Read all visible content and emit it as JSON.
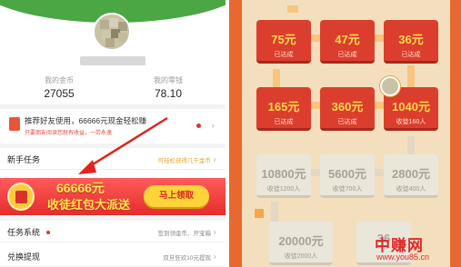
{
  "profile": {
    "coins_label": "我的金币",
    "coins_value": "27055",
    "change_label": "我的零钱",
    "change_value": "78.10"
  },
  "invite": {
    "text": "推荐好友使用，66666元现金轻松赚",
    "sub": "只要朋友阅读您就有收益，一劳永逸"
  },
  "rows": {
    "newbie": {
      "title": "新手任务",
      "hint": "可轻松获得几千金币"
    },
    "tasks": {
      "title": "任务系统",
      "hint": "签到领金币、开宝箱"
    },
    "withdraw": {
      "title": "兑换提现",
      "hint": "双旦狂欢10元提现"
    }
  },
  "banner": {
    "amount": "66666元",
    "text": "收徒红包大派送",
    "button": "马上领取"
  },
  "reward_map": {
    "cards": [
      {
        "amount": "75元",
        "status": "已达成",
        "done": true
      },
      {
        "amount": "47元",
        "status": "已达成",
        "done": true
      },
      {
        "amount": "36元",
        "status": "已达成",
        "done": true
      },
      {
        "amount": "165元",
        "status": "已达成",
        "done": true
      },
      {
        "amount": "360元",
        "status": "已达成",
        "done": true
      },
      {
        "amount": "1040元",
        "status": "收徒160人",
        "done": true
      },
      {
        "amount": "10800元",
        "status": "收徒1200人",
        "done": false
      },
      {
        "amount": "5600元",
        "status": "收徒700人",
        "done": false
      },
      {
        "amount": "2800元",
        "status": "收徒400人",
        "done": false
      },
      {
        "amount": "20000元",
        "status": "收徒2000人",
        "done": false
      },
      {
        "amount": "36",
        "status": "",
        "done": false
      }
    ]
  },
  "watermark": {
    "cn": "中赚网",
    "url": "www.you85.cn"
  },
  "colors": {
    "brand_green": "#4aa744",
    "banner_red": "#f23d3d",
    "banner_yellow": "#ffea4a",
    "card_red": "#dc3e2d",
    "card_grey": "#ebe6da"
  }
}
